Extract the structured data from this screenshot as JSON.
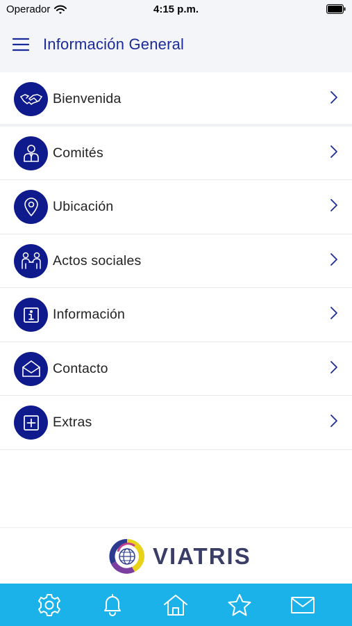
{
  "status_bar": {
    "carrier": "Operador",
    "time": "4:15 p.m."
  },
  "header": {
    "title": "Información General"
  },
  "menu": [
    {
      "label": "Bienvenida",
      "icon": "handshake-icon"
    },
    {
      "label": "Comités",
      "icon": "person-icon"
    },
    {
      "label": "Ubicación",
      "icon": "location-pin-icon"
    },
    {
      "label": "Actos sociales",
      "icon": "people-icon"
    },
    {
      "label": "Información",
      "icon": "info-icon"
    },
    {
      "label": "Contacto",
      "icon": "envelope-open-icon"
    },
    {
      "label": "Extras",
      "icon": "plus-square-icon"
    }
  ],
  "brand": {
    "name": "VIATRIS"
  },
  "tab_bar": [
    "gear-icon",
    "bell-icon",
    "home-icon",
    "star-icon",
    "mail-icon"
  ],
  "colors": {
    "accent": "#0f1a8c",
    "title": "#1a2b99",
    "tab_bar": "#1ab2e8",
    "header_bg": "#f4f5f9"
  }
}
